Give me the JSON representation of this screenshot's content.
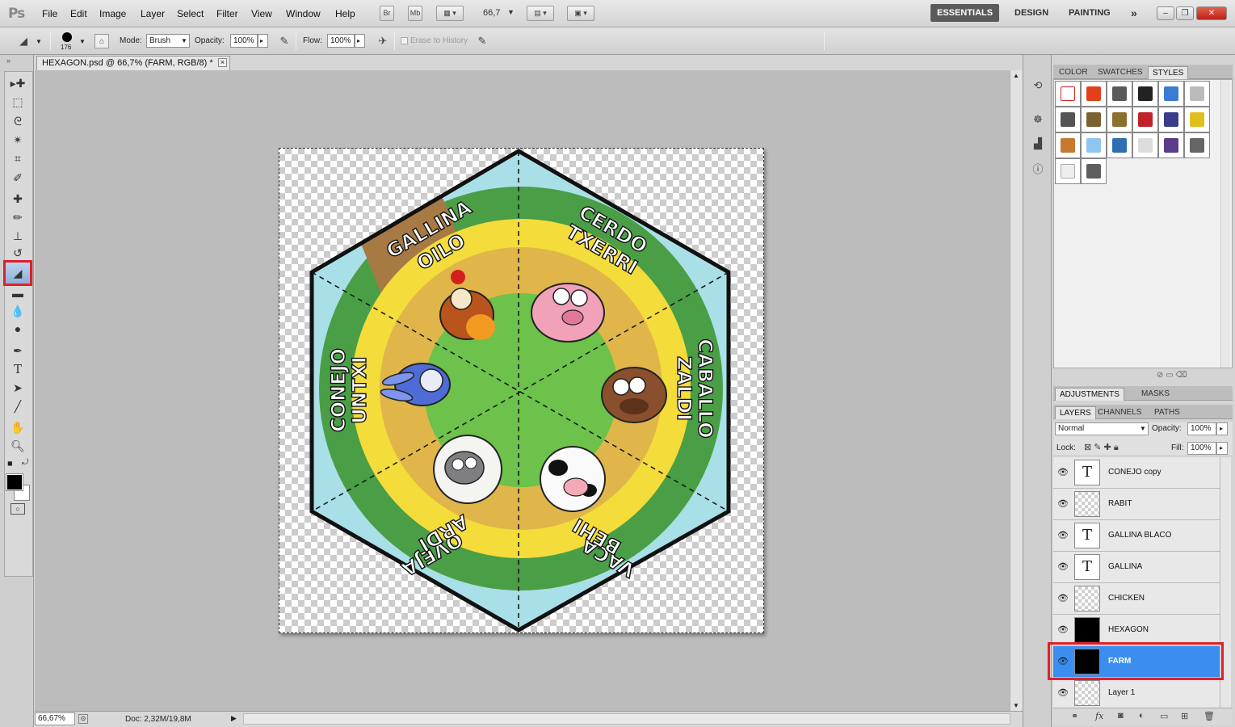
{
  "app": {
    "logo": "Ps"
  },
  "menu": [
    "File",
    "Edit",
    "Image",
    "Layer",
    "Select",
    "Filter",
    "View",
    "Window",
    "Help"
  ],
  "menubar_buttons": {
    "bridge": "Br",
    "mini": "Mb",
    "zoom": "66,7"
  },
  "workspaces": {
    "essentials": "ESSENTIALS",
    "design": "DESIGN",
    "painting": "PAINTING",
    "more": "»"
  },
  "window_controls": {
    "minimize": "–",
    "restore": "❐",
    "close": "✕"
  },
  "options": {
    "brush_size": "176",
    "mode_label": "Mode:",
    "mode_value": "Brush",
    "opacity_label": "Opacity:",
    "opacity_value": "100%",
    "flow_label": "Flow:",
    "flow_value": "100%",
    "erase_history_label": "Erase to History"
  },
  "document": {
    "tab_title": "HEXAGON.psd @ 66,7% (FARM, RGB/8) *",
    "zoom": "66,67%",
    "doc_size": "Doc: 2,32M/19,8M"
  },
  "artwork": {
    "labels": {
      "top_left": [
        "GALLINA",
        "OILO"
      ],
      "top_right": [
        "CERDO",
        "TXERRI"
      ],
      "right": [
        "CABALLO",
        "ZALDI"
      ],
      "bottom_right": [
        "VACA",
        "BEHI"
      ],
      "bottom_left": [
        "OVEJA",
        "ARDI"
      ],
      "left": [
        "CONEJO",
        "UNTXI"
      ]
    },
    "colors": {
      "sky": "#a9dfe6",
      "grass": "#4a9e46",
      "yellow": "#f4dc3a",
      "straw": "#e0b64a",
      "center": "#6cc24a"
    }
  },
  "color_panel": {
    "tabs": [
      "COLOR",
      "SWATCHES",
      "STYLES"
    ],
    "active": "STYLES"
  },
  "adjust_panel": {
    "tabs": [
      "ADJUSTMENTS",
      "MASKS"
    ]
  },
  "layers_panel": {
    "tabs": [
      "LAYERS",
      "CHANNELS",
      "PATHS"
    ],
    "blend_mode": "Normal",
    "opacity_label": "Opacity:",
    "opacity_value": "100%",
    "lock_label": "Lock:",
    "fill_label": "Fill:",
    "fill_value": "100%",
    "layers": [
      {
        "name": "CONEJO copy",
        "thumb": "text"
      },
      {
        "name": "RABIT",
        "thumb": "transparent"
      },
      {
        "name": "GALLINA BLACO",
        "thumb": "text"
      },
      {
        "name": "GALLINA",
        "thumb": "text"
      },
      {
        "name": "CHICKEN",
        "thumb": "transparent"
      },
      {
        "name": "HEXAGON",
        "thumb": "black"
      },
      {
        "name": "FARM",
        "thumb": "black",
        "selected": true
      },
      {
        "name": "Layer 1",
        "thumb": "transparent"
      }
    ]
  },
  "ui_colors": {
    "selection": "#3b8ef0",
    "highlight_box": "#e0202a"
  }
}
